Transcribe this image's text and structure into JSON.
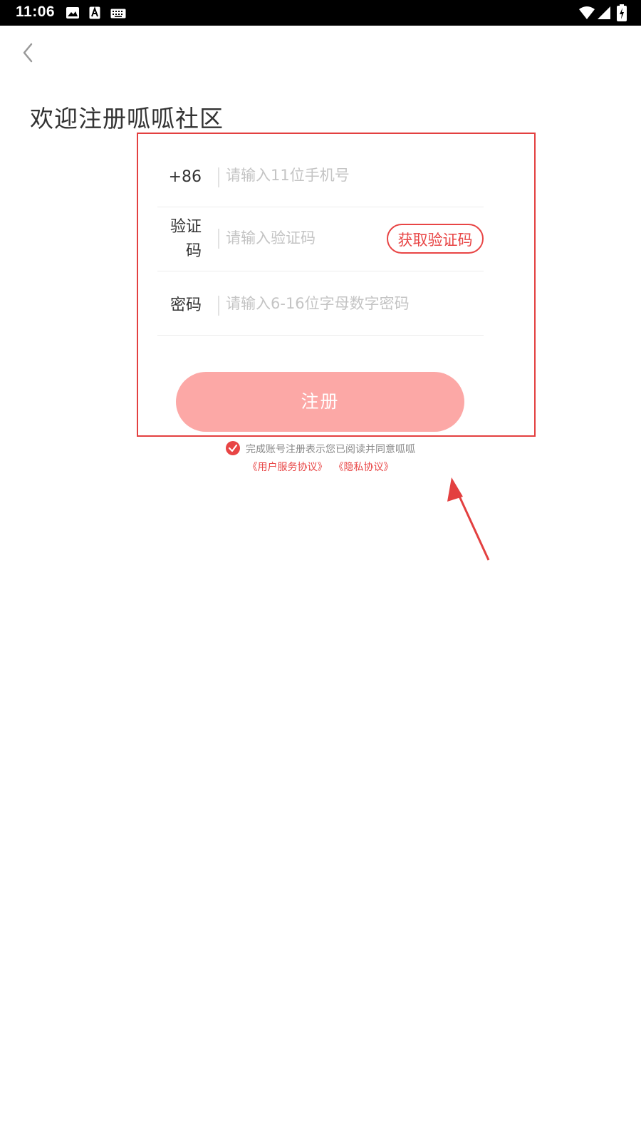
{
  "status_bar": {
    "time": "11:06",
    "left_icons": [
      "image-icon",
      "text-icon",
      "keyboard-icon"
    ],
    "right_icons": [
      "wifi-icon",
      "signal-icon",
      "battery-icon"
    ]
  },
  "header": {
    "back_icon": "chevron-left-icon"
  },
  "title": "欢迎注册呱呱社区",
  "form": {
    "phone": {
      "label": "+86",
      "placeholder": "请输入11位手机号"
    },
    "code": {
      "label": "验证码",
      "placeholder": "请输入验证码",
      "button": "获取验证码"
    },
    "password": {
      "label": "密码",
      "placeholder": "请输入6-16位字母数字密码"
    },
    "submit": "注册"
  },
  "agreement": {
    "checked": true,
    "text": "完成账号注册表示您已阅读并同意呱呱",
    "user_agreement": "《用户服务协议》",
    "privacy_agreement": "《隐私协议》"
  },
  "colors": {
    "accent": "#e84545",
    "button_disabled": "#fca8a6",
    "annotation": "#e34040"
  }
}
